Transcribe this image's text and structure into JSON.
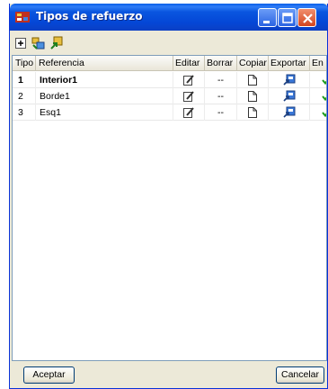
{
  "window": {
    "title": "Tipos de refuerzo",
    "icon": "app-icon",
    "controls": [
      "minimize-icon",
      "maximize-icon",
      "close-icon"
    ]
  },
  "toolbar": {
    "tools": [
      "add-icon",
      "import-icon",
      "export-icon"
    ]
  },
  "table": {
    "headers": [
      "Tipo",
      "Referencia",
      "Editar",
      "Borrar",
      "Copiar",
      "Exportar",
      "En uso"
    ],
    "rows": [
      {
        "tipo": "1",
        "referencia": "Interior1",
        "bold": true,
        "borrar": "--"
      },
      {
        "tipo": "2",
        "referencia": "Borde1",
        "bold": false,
        "borrar": "--"
      },
      {
        "tipo": "3",
        "referencia": "Esq1",
        "bold": false,
        "borrar": "--"
      }
    ],
    "row_icons": {
      "editar": "edit-icon",
      "copiar": "copy-icon",
      "exportar": "export-icon",
      "en_uso": "check-icon"
    }
  },
  "buttons": {
    "accept": "Aceptar",
    "cancel": "Cancelar"
  },
  "colors": {
    "titlebar": "#0447d6",
    "check": "#1a9a1a",
    "grid_border": "#7f9db9"
  }
}
